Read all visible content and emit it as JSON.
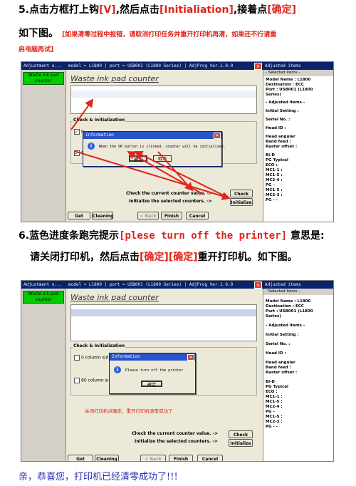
{
  "step5": {
    "num": "5.",
    "text_a": "点击方框打上钩",
    "text_b": "[V]",
    "text_c": ",然后点击",
    "text_d": "[Initialiation]",
    "text_e": ",接着点",
    "text_f": "[确定]",
    "line2": "如下图。",
    "note": "[如果清零过程中报错，请取消打印任务并重开打印机再清，如果还不行请重",
    "note2": "启电脑再试]"
  },
  "step6": {
    "num": "6.",
    "text_a": "蓝色进度条跑完提示",
    "text_b": "[plese turn off the printer]",
    "text_c": " 意思是:",
    "line2_a": "请关闭打印机，然后点击",
    "line2_b": "[确定][确定]",
    "line2_c": "重开打印机。如下图。"
  },
  "footer": "亲，恭喜您，打印机已经清零成功了!!!",
  "colors": {
    "red": "#e0251b",
    "titlebar": "#0a246a",
    "green": "#00cc00"
  },
  "shot1": {
    "title_left": "Adjustment o...",
    "title_mid": "model = L1800 | port = USB001 (L1800 Series) | AdjProg Ver.1.0.0",
    "title_right": "Adjusted items",
    "left_item": "Waste ink pad counter",
    "window_title": "Waste ink pad counter",
    "group_label": "Check & Initialization",
    "chk1": "0",
    "chk2": "80",
    "row_check": "Check the current counter value.  ->",
    "row_init": "Initialize the selected counters.  ->",
    "btn_check": "Check",
    "btn_init": "Initialize",
    "btn_get_status": "Get Status",
    "btn_cleaning": "Cleaning",
    "btn_back": "< Back",
    "btn_finish": "Finish",
    "btn_cancel": "Cancel",
    "dlg_title": "Information",
    "dlg_msg": "When the OK button is clicked, counter will be initialized.",
    "dlg_ok": "确定",
    "dlg_cancel": "取消",
    "right": [
      "- Selected items -",
      "Model Name : L1800",
      "Destination : ECC",
      "Port : USB001 (L1800",
      "Series)",
      "- Adjusted items -",
      "Initial Setting :",
      "Serial No. :",
      "Head ID :",
      "Head angular",
      "  Band feed :",
      "  Raster offset :",
      "Bi-D",
      "PG Typical",
      "  ECO  :",
      "  MC1-1 :",
      "  MC1-5 :",
      "  MC2-4 :",
      "PG -",
      "  MC1-5 :",
      "  MC2-3 :",
      "PG - -"
    ]
  },
  "shot2": {
    "title_left": "Adjustment o...",
    "title_mid": "model = L1800 | port = USB001 (L1800 Series) | AdjProg Ver.1.0.0",
    "title_right": "Adjusted items",
    "left_item": "Waste ink pad counter",
    "window_title": "Waste ink pad counter",
    "group_label": "Check & Initialization",
    "chk1": "0 column sid",
    "chk2": "80 column sic",
    "red_note": "关闭打印机点确定，重开打印机清零成功了",
    "row_check": "Check the current counter value.  ->",
    "row_init": "Initialize the selected counters.  ->",
    "btn_check": "Check",
    "btn_init": "Initialize",
    "btn_get_status": "Get Status",
    "btn_cleaning": "Cleaning",
    "btn_back": "< Back",
    "btn_finish": "Finish",
    "btn_cancel": "Cancel",
    "dlg_title": "Information",
    "dlg_msg": "Please turn off the printer.",
    "dlg_ok": "確定",
    "right": [
      "- Selected items -",
      "Model Name : L1800",
      "Destination : ECC",
      "Port : USB001 (L1800",
      "Series)",
      "- Adjusted items -",
      "Initial Setting :",
      "Serial No. :",
      "Head ID :",
      "Head angular",
      "  Band feed :",
      "  Raster offset :",
      "Bi-D",
      "PG Typical",
      "  ECO  :",
      "  MC1-1 :",
      "  MC1-5 :",
      "  MC2-4 :",
      "PG -",
      "  MC1-5 :",
      "  MC2-3 :",
      "PG - -"
    ]
  }
}
